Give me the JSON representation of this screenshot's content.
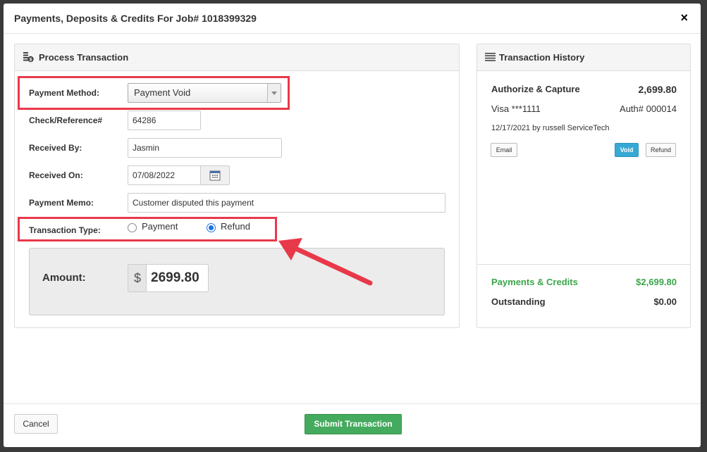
{
  "modal": {
    "title": "Payments, Deposits & Credits For Job# 1018399329",
    "close_glyph": "×"
  },
  "process": {
    "title": "Process Transaction",
    "payment_method": {
      "label": "Payment Method:",
      "value": "Payment Void"
    },
    "check_reference": {
      "label": "Check/Reference#",
      "value": "64286"
    },
    "received_by": {
      "label": "Received By:",
      "value": "Jasmin"
    },
    "received_on": {
      "label": "Received On:",
      "value": "07/08/2022"
    },
    "payment_memo": {
      "label": "Payment Memo:",
      "value": "Customer disputed this payment"
    },
    "transaction_type": {
      "label": "Transaction Type:",
      "options": [
        {
          "label": "Payment",
          "selected": false
        },
        {
          "label": "Refund",
          "selected": true
        }
      ]
    },
    "amount": {
      "label": "Amount:",
      "currency": "$",
      "value": "2699.80"
    }
  },
  "history": {
    "title": "Transaction History",
    "entry": {
      "type": "Authorize & Capture",
      "amount": "2,699.80",
      "card": "Visa ***1111",
      "auth": "Auth# 000014",
      "date_by": "12/17/2021 by russell ServiceTech",
      "buttons": {
        "email": "Email",
        "void": "Void",
        "refund": "Refund"
      }
    },
    "summary": {
      "payments_label": "Payments & Credits",
      "payments_value": "$2,699.80",
      "outstanding_label": "Outstanding",
      "outstanding_value": "$0.00"
    }
  },
  "footer": {
    "cancel": "Cancel",
    "submit": "Submit Transaction"
  },
  "colors": {
    "highlight": "#e8394a",
    "submit_green": "#44aa5e",
    "void_blue": "#36a9d4",
    "summary_green": "#3aa54a"
  },
  "icons": {
    "process": "coins-icon",
    "history": "list-icon",
    "calendar": "calendar-icon",
    "arrow": "annotation-arrow"
  }
}
